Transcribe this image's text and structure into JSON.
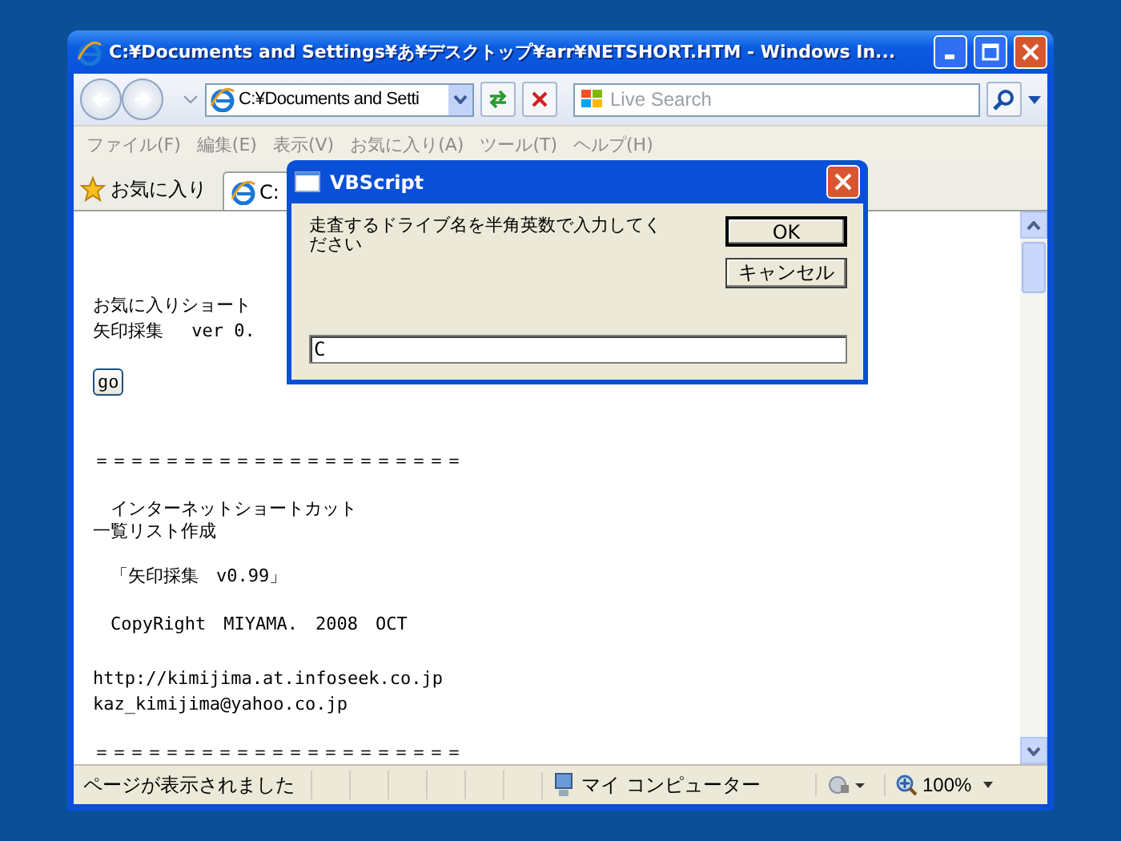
{
  "window": {
    "title": "C:¥Documents and Settings¥あ¥デスクトップ¥arr¥NETSHORT.HTM - Windows In..."
  },
  "toolbar": {
    "address": "C:¥Documents and Setti",
    "search_placeholder": "Live Search"
  },
  "menu": [
    "ファイル(F)",
    "編集(E)",
    "表示(V)",
    "お気に入り(A)",
    "ツール(T)",
    "ヘルプ(H)"
  ],
  "favorites": {
    "label": "お気に入り",
    "tab": "C:"
  },
  "content": [
    {
      "kind": "text",
      "text": "お気に入りショート"
    },
    {
      "kind": "text",
      "text": "矢印採集　 ver 0."
    },
    {
      "kind": "button",
      "text": "go"
    },
    {
      "kind": "text",
      "text": "＝＝＝＝＝＝＝＝＝＝＝＝＝＝＝＝＝＝＝＝＝"
    },
    {
      "kind": "text",
      "text": "　インターネットショートカット"
    },
    {
      "kind": "text",
      "text": "一覧リスト作成"
    },
    {
      "kind": "text",
      "text": "　「矢印採集　v0.99」"
    },
    {
      "kind": "text",
      "text": "　CopyRight　MIYAMA.　2008　OCT"
    },
    {
      "kind": "text",
      "text": "http://kimijima.at.infoseek.co.jp"
    },
    {
      "kind": "text",
      "text": "kaz_kimijima@yahoo.co.jp"
    },
    {
      "kind": "text",
      "text": "＝＝＝＝＝＝＝＝＝＝＝＝＝＝＝＝＝＝＝＝＝"
    }
  ],
  "dialog": {
    "title": "VBScript",
    "prompt": "走査するドライブ名を半角英数で入力してください",
    "ok": "OK",
    "cancel": "キャンセル",
    "value": "C"
  },
  "status_bar": {
    "text": "ページが表示されました",
    "zone": "マイ コンピューター",
    "zoom": "100%"
  }
}
